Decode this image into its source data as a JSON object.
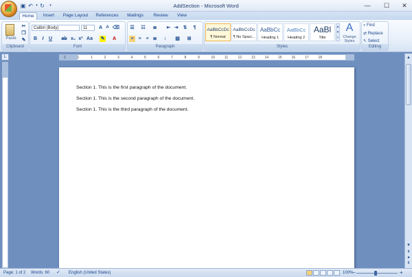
{
  "window": {
    "title": "AddSection - Microsoft Word"
  },
  "tabs": [
    "Home",
    "Insert",
    "Page Layout",
    "References",
    "Mailings",
    "Review",
    "View"
  ],
  "clipboard": {
    "paste_label": "Paste",
    "group_label": "Clipboard"
  },
  "font": {
    "name": "Calibri (Body)",
    "size": "11",
    "group_label": "Font"
  },
  "paragraph": {
    "group_label": "Paragraph"
  },
  "styles": {
    "items": [
      {
        "preview": "AaBbCcDc",
        "name": "¶ Normal"
      },
      {
        "preview": "AaBbCcDc",
        "name": "¶ No Spaci..."
      },
      {
        "preview": "AaBbCc",
        "name": "Heading 1"
      },
      {
        "preview": "AaBbCc",
        "name": "Heading 2"
      },
      {
        "preview": "AaBl",
        "name": "Title"
      }
    ],
    "change_label": "Change Styles",
    "group_label": "Styles"
  },
  "editing": {
    "find": "Find",
    "replace": "Replace",
    "select": "Select",
    "group_label": "Editing"
  },
  "ruler": {
    "numbers": [
      "2",
      "1",
      "1",
      "2",
      "3",
      "4",
      "5",
      "6",
      "7",
      "8",
      "9",
      "10",
      "11",
      "12",
      "13",
      "14",
      "15",
      "16",
      "17",
      "18"
    ]
  },
  "document": {
    "paragraphs": [
      "Section 1. This is the first paragraph of the document.",
      "Section 1. This is the second paragraph of the document.",
      "Section 1. This is the third paragraph of the document."
    ]
  },
  "status": {
    "page": "Page: 1 of 2",
    "words": "Words: 60",
    "language": "English (United States)",
    "zoom": "100%"
  },
  "colors": {
    "ribbon": "#e8f0fa",
    "workspace": "#6f8fbf",
    "accent": "#15428b"
  }
}
